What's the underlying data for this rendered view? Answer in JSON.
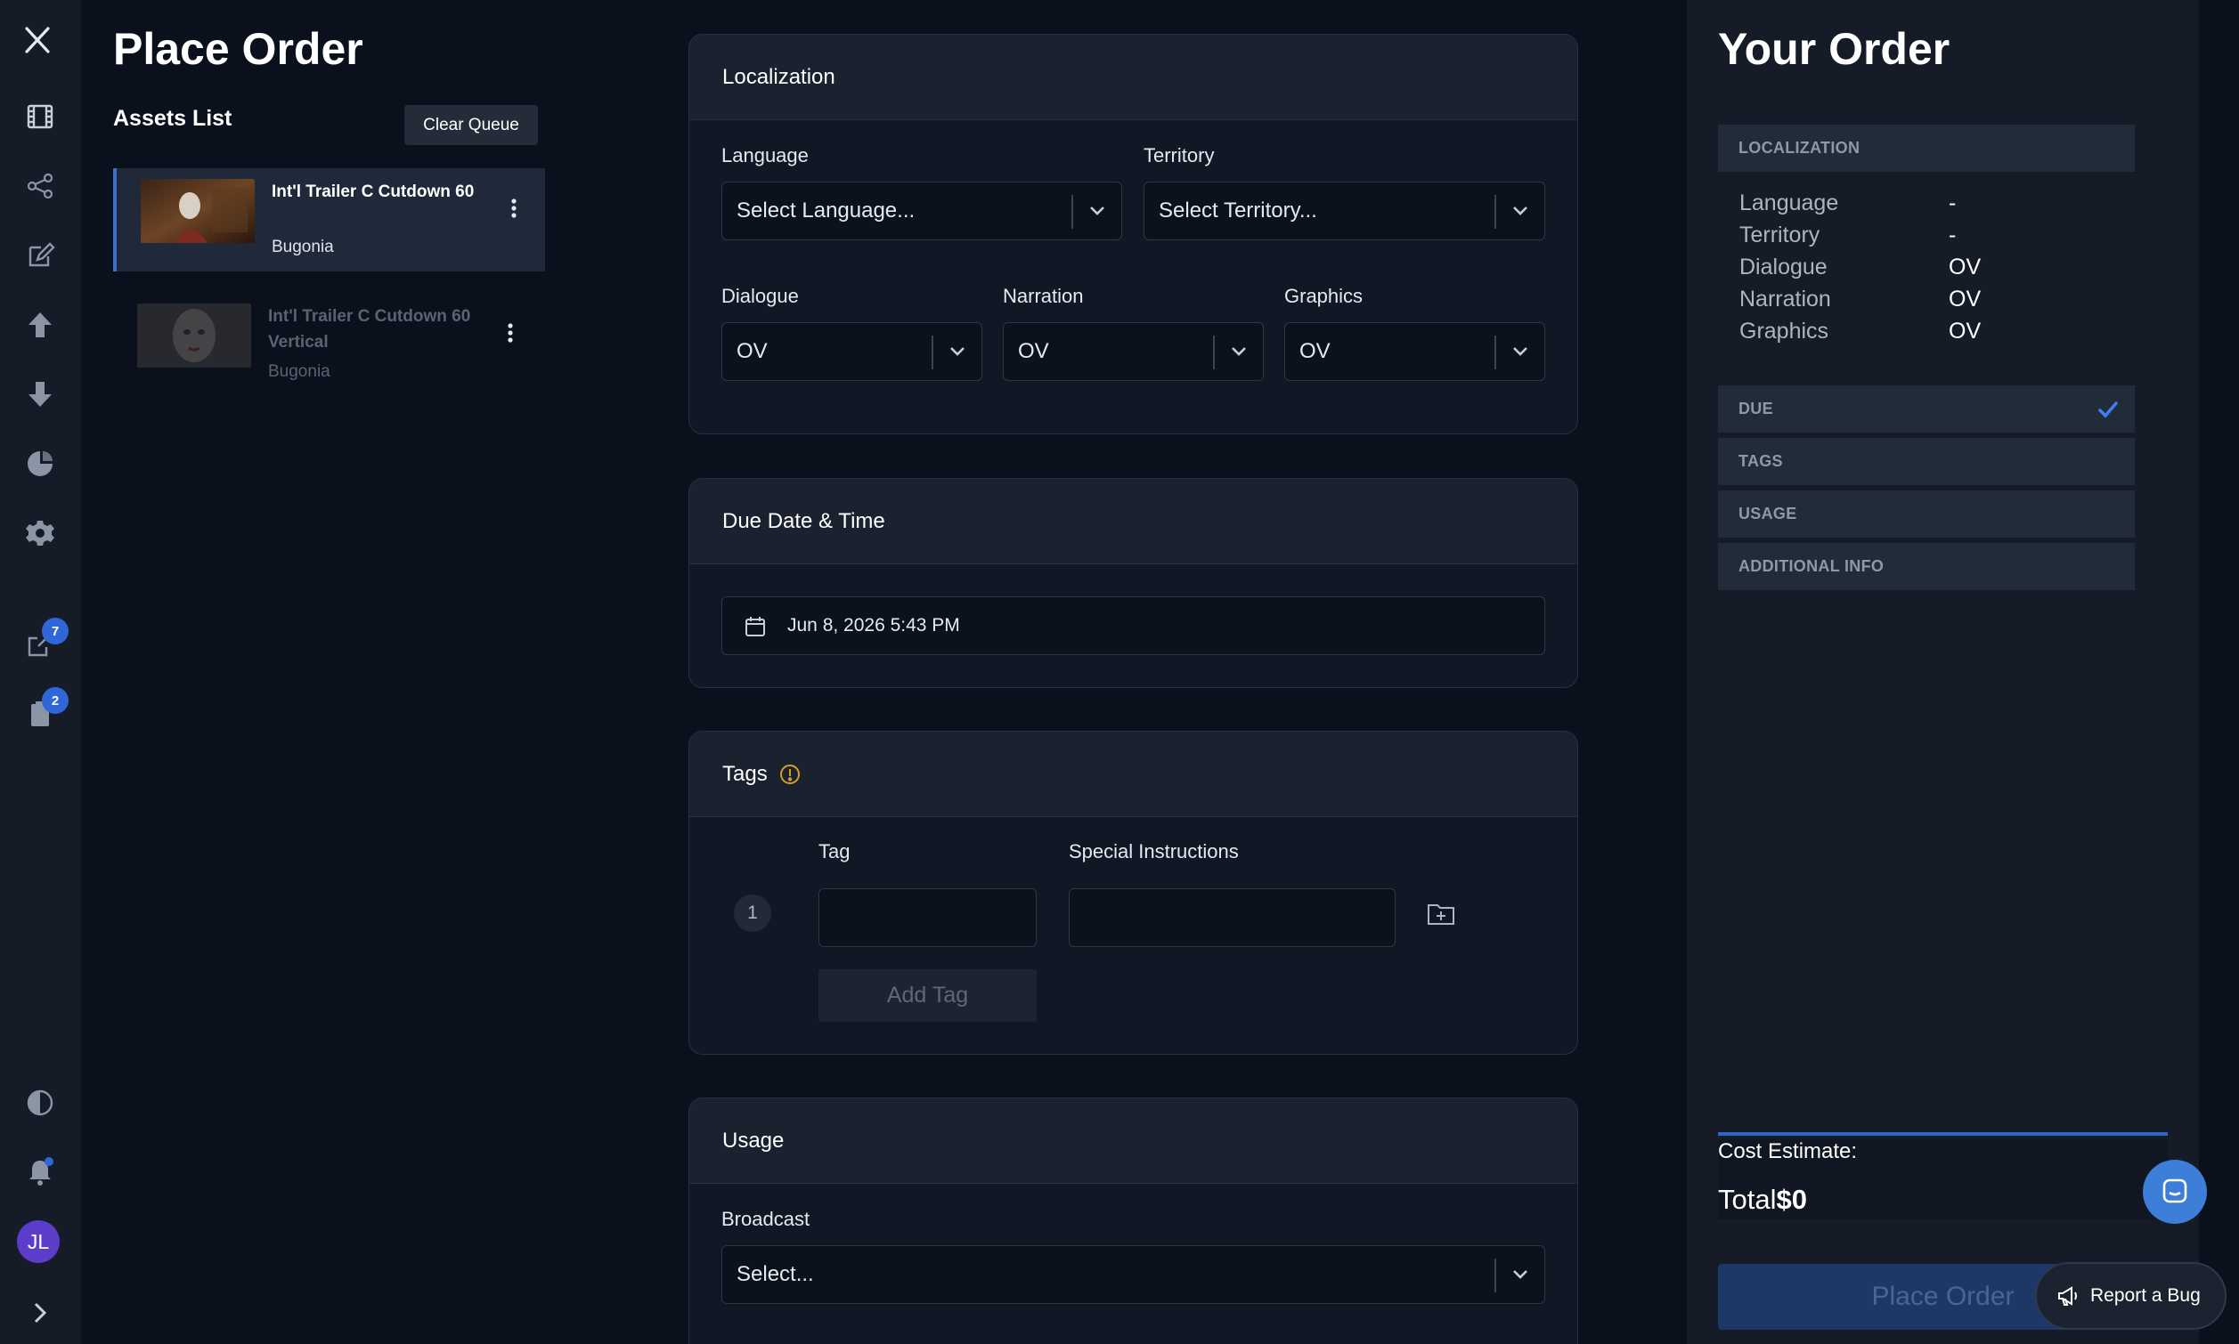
{
  "sidebar": {
    "icons": [
      "x-logo-icon",
      "film-icon",
      "share-icon",
      "edit-doc-icon",
      "upload-icon",
      "download-icon",
      "chart-icon",
      "gear-icon",
      "external-link-icon",
      "clipboard-icon",
      "contrast-icon",
      "bell-icon",
      "expand-icon"
    ],
    "badges": {
      "external": "7",
      "clipboard": "2"
    },
    "avatar_initials": "JL"
  },
  "left": {
    "title": "Place Order",
    "assets_title": "Assets List",
    "clear_label": "Clear Queue",
    "assets": [
      {
        "name": "Int'l Trailer C Cutdown 60",
        "subtitle": "Bugonia",
        "active": true
      },
      {
        "name": "Int'l Trailer C Cutdown 60 Vertical",
        "subtitle": "Bugonia",
        "active": false
      }
    ]
  },
  "localization": {
    "header": "Localization",
    "language_label": "Language",
    "language_value": "Select Language...",
    "territory_label": "Territory",
    "territory_value": "Select Territory...",
    "dialogue_label": "Dialogue",
    "dialogue_value": "OV",
    "narration_label": "Narration",
    "narration_value": "OV",
    "graphics_label": "Graphics",
    "graphics_value": "OV"
  },
  "due": {
    "header": "Due Date & Time",
    "value": "Jun 8, 2026 5:43 PM"
  },
  "tags": {
    "header": "Tags",
    "tag_label": "Tag",
    "instructions_label": "Special Instructions",
    "row_number": "1",
    "tag_value": "",
    "instructions_value": "",
    "add_label": "Add Tag"
  },
  "usage": {
    "header": "Usage",
    "broadcast_label": "Broadcast",
    "broadcast_value": "Select..."
  },
  "order": {
    "title": "Your Order",
    "sections": {
      "localization": "LOCALIZATION",
      "due": "DUE",
      "tags": "TAGS",
      "usage": "USAGE",
      "additional": "ADDITIONAL INFO"
    },
    "rows": [
      {
        "label": "Language",
        "value": "-"
      },
      {
        "label": "Territory",
        "value": "-"
      },
      {
        "label": "Dialogue",
        "value": "OV"
      },
      {
        "label": "Narration",
        "value": "OV"
      },
      {
        "label": "Graphics",
        "value": "OV"
      }
    ],
    "cost_label": "Cost Estimate:",
    "total_label": "Total",
    "total_value": "$0",
    "place_label": "Place Order"
  },
  "report_bug_label": "Report a Bug",
  "colors": {
    "accent": "#2f67d8",
    "warning": "#d79b26",
    "background": "#0b111c"
  }
}
